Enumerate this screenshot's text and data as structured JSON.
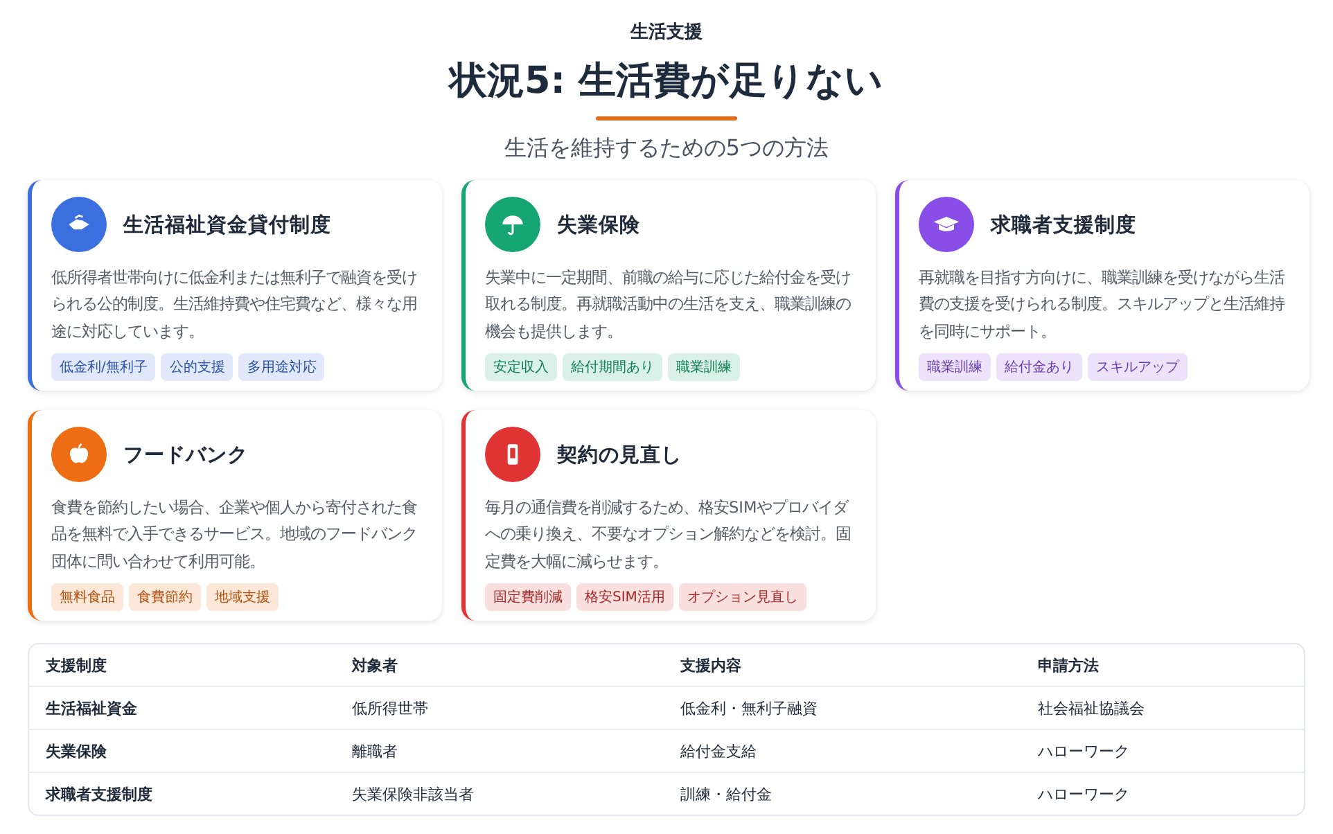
{
  "header": {
    "category": "生活支援",
    "title": "状況5: 生活費が足りない",
    "subtitle": "生活を維持するための5つの方法"
  },
  "cards": [
    {
      "title": "生活福祉資金貸付制度",
      "color": "#3b6fe0",
      "description": "低所得者世帯向けに低金利または無利子で融資を受けられる公的制度。生活維持費や住宅費など、様々な用途に対応しています。",
      "tags": [
        "低金利/無利子",
        "公的支援",
        "多用途対応"
      ]
    },
    {
      "title": "失業保険",
      "color": "#16a673",
      "description": "失業中に一定期間、前職の給与に応じた給付金を受け取れる制度。再就職活動中の生活を支え、職業訓練の機会も提供します。",
      "tags": [
        "安定収入",
        "給付期間あり",
        "職業訓練"
      ]
    },
    {
      "title": "求職者支援制度",
      "color": "#8a4ee8",
      "description": "再就職を目指す方向けに、職業訓練を受けながら生活費の支援を受けられる制度。スキルアップと生活維持を同時にサポート。",
      "tags": [
        "職業訓練",
        "給付金あり",
        "スキルアップ"
      ]
    },
    {
      "title": "フードバンク",
      "color": "#ee6c12",
      "description": "食費を節約したい場合、企業や個人から寄付された食品を無料で入手できるサービス。地域のフードバンク団体に問い合わせて利用可能。",
      "tags": [
        "無料食品",
        "食費節約",
        "地域支援"
      ]
    },
    {
      "title": "契約の見直し",
      "color": "#e03434",
      "description": "毎月の通信費を削減するため、格安SIMやプロバイダへの乗り換え、不要なオプション解約などを検討。固定費を大幅に減らせます。",
      "tags": [
        "固定費削減",
        "格安SIM活用",
        "オプション見直し"
      ]
    }
  ],
  "table": {
    "columns": [
      "支援制度",
      "対象者",
      "支援内容",
      "申請方法"
    ],
    "rows": [
      [
        "生活福祉資金",
        "低所得世帯",
        "低金利・無利子融資",
        "社会福祉協議会"
      ],
      [
        "失業保険",
        "離職者",
        "給付金支給",
        "ハローワーク"
      ],
      [
        "求職者支援制度",
        "失業保険非該当者",
        "訓練・給付金",
        "ハローワーク"
      ]
    ]
  }
}
